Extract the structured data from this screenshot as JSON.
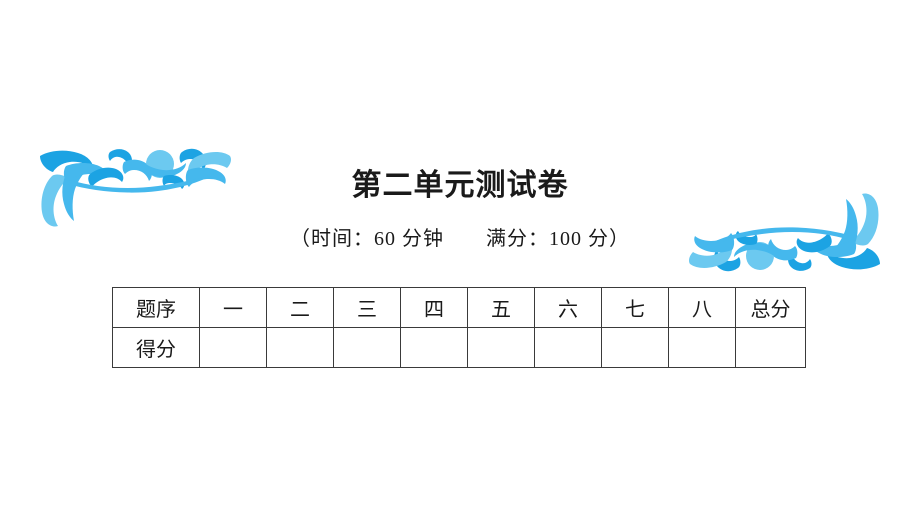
{
  "document": {
    "title": "第二单元测试卷",
    "subtitle": "（时间：60 分钟　　满分：100 分）",
    "subtitle_parts": {
      "open_paren": "（",
      "time_label": "时间：",
      "time_value": "60 分钟",
      "score_label": "满分：",
      "score_value": "100 分",
      "close_paren": "）"
    }
  },
  "score_table": {
    "row_header_label": "题序",
    "row_score_label": "得分",
    "question_numbers": [
      "一",
      "二",
      "三",
      "四",
      "五",
      "六",
      "七",
      "八"
    ],
    "total_label": "总分",
    "score_values": [
      "",
      "",
      "",
      "",
      "",
      "",
      "",
      "",
      ""
    ],
    "rows": [
      {
        "label": "题序",
        "cells": [
          "一",
          "二",
          "三",
          "四",
          "五",
          "六",
          "七",
          "八",
          "总分"
        ]
      },
      {
        "label": "得分",
        "cells": [
          "",
          "",
          "",
          "",
          "",
          "",
          "",
          "",
          ""
        ]
      }
    ]
  },
  "ornaments": {
    "top_left_name": "floral-flourish-ornament",
    "bottom_right_name": "floral-flourish-ornament",
    "color_dark": "#1CA3E3",
    "color_mid": "#45B8ED",
    "color_light": "#86D2F4"
  },
  "colors": {
    "background": "#FFFFFF",
    "text": "#1A1A1A",
    "table_border": "#3A3A3A",
    "ornament_accent": "#1CA3E3"
  }
}
